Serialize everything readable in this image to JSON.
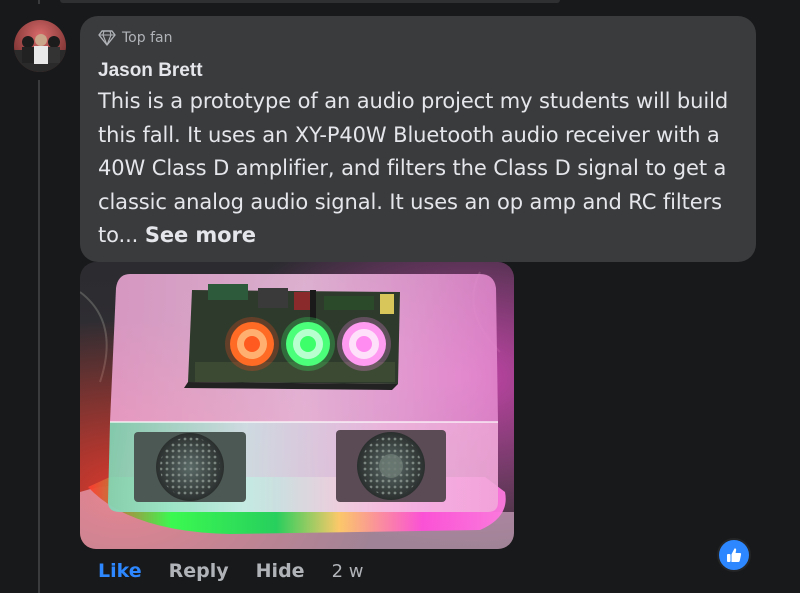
{
  "comment": {
    "badge": {
      "icon": "diamond-icon",
      "label": "Top fan"
    },
    "author": "Jason Brett",
    "text": "This is a prototype of an audio project my students will build this fall. It uses an XY-P40W Bluetooth audio receiver with a 40W Class D amplifier, and filters the Class D signal to get a classic analog audio signal. It uses an op amp and RC filters to... ",
    "see_more": "See more",
    "attachment": {
      "type": "photo",
      "knob_colors": [
        "#ff5a1f",
        "#3dff6a",
        "#ff8cf0"
      ]
    },
    "reaction": {
      "icon": "like-icon",
      "color": "#2d88ff"
    }
  },
  "actions": {
    "like": "Like",
    "reply": "Reply",
    "hide": "Hide",
    "timestamp": "2 w"
  },
  "colors": {
    "background": "#18191a",
    "bubble": "#3a3b3c",
    "text": "#e4e6eb",
    "muted": "#b0b3b8",
    "accent": "#2d88ff"
  }
}
